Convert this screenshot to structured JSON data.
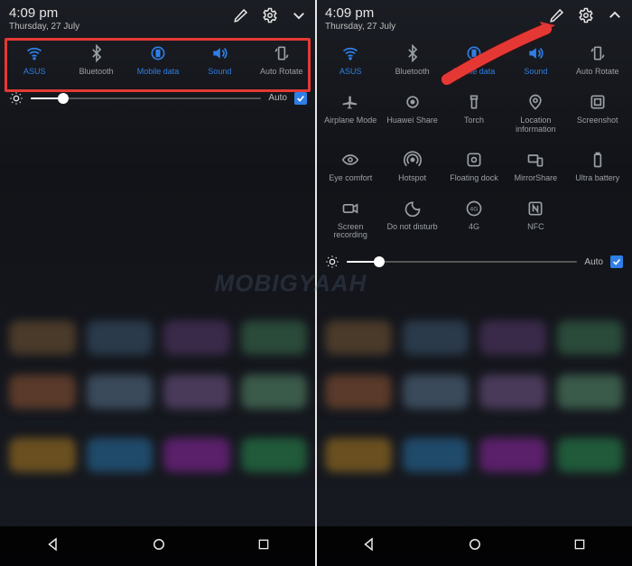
{
  "status": {
    "time": "4:09 pm",
    "date": "Thursday, 27 July"
  },
  "header_icons": {
    "edit": "edit-icon",
    "settings": "gear-icon",
    "expand": "chevron-down-icon",
    "collapse": "chevron-up-icon"
  },
  "left": {
    "tiles": [
      {
        "id": "wifi",
        "label": "ASUS",
        "active": true
      },
      {
        "id": "bt",
        "label": "Bluetooth",
        "active": false
      },
      {
        "id": "data",
        "label": "Mobile data",
        "active": true
      },
      {
        "id": "sound",
        "label": "Sound",
        "active": true
      },
      {
        "id": "rotate",
        "label": "Auto Rotate",
        "active": false
      }
    ],
    "brightness": {
      "percent": 14,
      "auto_label": "Auto",
      "auto_checked": true
    }
  },
  "right": {
    "tiles": [
      {
        "id": "wifi",
        "label": "ASUS",
        "active": true
      },
      {
        "id": "bt",
        "label": "Bluetooth",
        "active": false
      },
      {
        "id": "data",
        "label": "Mobile data",
        "active": true
      },
      {
        "id": "sound",
        "label": "Sound",
        "active": true
      },
      {
        "id": "rotate",
        "label": "Auto Rotate",
        "active": false
      },
      {
        "id": "airplane",
        "label": "Airplane Mode",
        "active": false
      },
      {
        "id": "hwshare",
        "label": "Huawei Share",
        "active": false
      },
      {
        "id": "torch",
        "label": "Torch",
        "active": false
      },
      {
        "id": "location",
        "label": "Location information",
        "active": false
      },
      {
        "id": "sshot",
        "label": "Screenshot",
        "active": false
      },
      {
        "id": "eye",
        "label": "Eye comfort",
        "active": false
      },
      {
        "id": "hotspot",
        "label": "Hotspot",
        "active": false
      },
      {
        "id": "dock",
        "label": "Floating dock",
        "active": false
      },
      {
        "id": "mirror",
        "label": "MirrorShare",
        "active": false
      },
      {
        "id": "ultra",
        "label": "Ultra battery",
        "active": false
      },
      {
        "id": "record",
        "label": "Screen recording",
        "active": false
      },
      {
        "id": "dnd",
        "label": "Do not disturb",
        "active": false
      },
      {
        "id": "4g",
        "label": "4G",
        "active": false
      },
      {
        "id": "nfc",
        "label": "NFC",
        "active": false
      }
    ],
    "brightness": {
      "percent": 14,
      "auto_label": "Auto",
      "auto_checked": true
    }
  },
  "nav": {
    "back": "back-icon",
    "home": "home-icon",
    "recent": "recent-icon"
  },
  "watermark": "MOBIGYAAH",
  "colors": {
    "accent": "#2f7fe6",
    "highlight": "#e53935"
  }
}
